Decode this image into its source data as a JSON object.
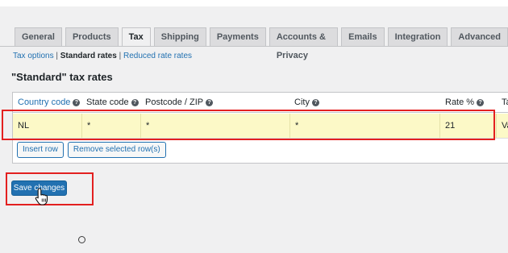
{
  "tabs": [
    {
      "label": "General"
    },
    {
      "label": "Products"
    },
    {
      "label": "Tax",
      "active": true
    },
    {
      "label": "Shipping"
    },
    {
      "label": "Payments"
    },
    {
      "label": "Accounts & Privacy"
    },
    {
      "label": "Emails"
    },
    {
      "label": "Integration"
    },
    {
      "label": "Advanced"
    }
  ],
  "subnav": {
    "tax_options": "Tax options",
    "separator1": "|",
    "standard_rates": "Standard rates",
    "separator2": "|",
    "reduced_rates": "Reduced rate rates"
  },
  "heading": "\"Standard\" tax rates",
  "table": {
    "headers": {
      "country_code": "Country code",
      "state_code": "State code",
      "postcode": "Postcode / ZIP",
      "city": "City",
      "rate": "Rate %",
      "extra": "Ta"
    },
    "row": {
      "country_code": "NL",
      "state_code": "*",
      "postcode": "*",
      "city": "*",
      "rate": "21",
      "extra": "Va"
    }
  },
  "buttons": {
    "insert_row": "Insert row",
    "remove_rows": "Remove selected row(s)",
    "save_changes": "Save changes"
  },
  "icons": {
    "help": "help-icon",
    "cursor": "hand-pointer-icon"
  },
  "colors": {
    "accent": "#2271b1",
    "highlight": "#e32020",
    "row_bg": "#fcf9c7"
  }
}
